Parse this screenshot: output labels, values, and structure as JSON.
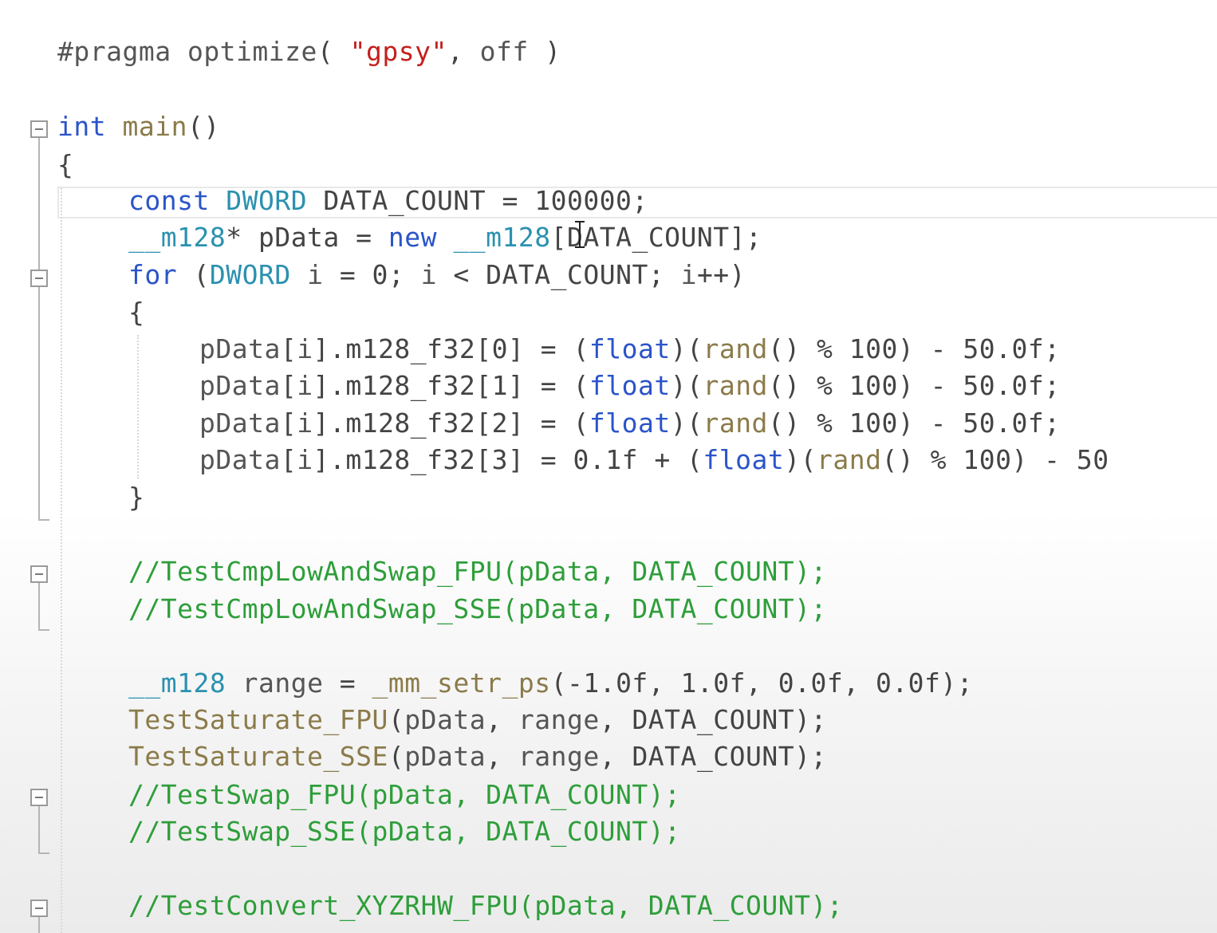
{
  "colors": {
    "keyword": "#2b54c9",
    "type": "#2b91af",
    "identifier": "#555555",
    "function": "#8b7b4a",
    "string": "#c3201e",
    "comment": "#2e9e3a",
    "number": "#3a3a3a",
    "punct": "#444444",
    "macro": "#555555"
  },
  "editor": {
    "lines": [
      {
        "tokens": [
          {
            "t": "#pragma",
            "c": "macro"
          },
          {
            "t": " optimize",
            "c": "macro"
          },
          {
            "t": "( ",
            "c": "punct"
          },
          {
            "t": "\"gpsy\"",
            "c": "string"
          },
          {
            "t": ", ",
            "c": "punct"
          },
          {
            "t": "off",
            "c": "macro"
          },
          {
            "t": " )",
            "c": "punct"
          }
        ]
      },
      {
        "tokens": [
          {
            "t": "int",
            "c": "keyword"
          },
          {
            "t": " ",
            "c": "punct"
          },
          {
            "t": "main",
            "c": "function"
          },
          {
            "t": "()",
            "c": "punct"
          }
        ]
      },
      {
        "tokens": [
          {
            "t": "{",
            "c": "punct"
          }
        ]
      },
      {
        "tokens": [
          {
            "t": "const",
            "c": "keyword"
          },
          {
            "t": " ",
            "c": "punct"
          },
          {
            "t": "DWORD",
            "c": "type"
          },
          {
            "t": " DATA_COUNT = 100000;",
            "c": "punct"
          }
        ]
      },
      {
        "tokens": [
          {
            "t": "__m128",
            "c": "type"
          },
          {
            "t": "* pData = ",
            "c": "punct"
          },
          {
            "t": "new",
            "c": "keyword"
          },
          {
            "t": " ",
            "c": "punct"
          },
          {
            "t": "__m128",
            "c": "type"
          },
          {
            "t": "[DATA_COUNT];",
            "c": "punct"
          }
        ]
      },
      {
        "tokens": [
          {
            "t": "for",
            "c": "keyword"
          },
          {
            "t": " (",
            "c": "punct"
          },
          {
            "t": "DWORD",
            "c": "type"
          },
          {
            "t": " ",
            "c": "punct"
          },
          {
            "t": "i",
            "c": "identifier"
          },
          {
            "t": " = 0; ",
            "c": "punct"
          },
          {
            "t": "i",
            "c": "identifier"
          },
          {
            "t": " < DATA_COUNT; ",
            "c": "punct"
          },
          {
            "t": "i",
            "c": "identifier"
          },
          {
            "t": "++)",
            "c": "punct"
          }
        ]
      },
      {
        "tokens": [
          {
            "t": "{",
            "c": "punct"
          }
        ]
      },
      {
        "tokens": [
          {
            "t": "pData",
            "c": "identifier"
          },
          {
            "t": "[",
            "c": "punct"
          },
          {
            "t": "i",
            "c": "identifier"
          },
          {
            "t": "].m128_f32[0] = (",
            "c": "punct"
          },
          {
            "t": "float",
            "c": "keyword"
          },
          {
            "t": ")(",
            "c": "punct"
          },
          {
            "t": "rand",
            "c": "function"
          },
          {
            "t": "() % 100) - 50.0f;",
            "c": "punct"
          }
        ]
      },
      {
        "tokens": [
          {
            "t": "pData",
            "c": "identifier"
          },
          {
            "t": "[",
            "c": "punct"
          },
          {
            "t": "i",
            "c": "identifier"
          },
          {
            "t": "].m128_f32[1] = (",
            "c": "punct"
          },
          {
            "t": "float",
            "c": "keyword"
          },
          {
            "t": ")(",
            "c": "punct"
          },
          {
            "t": "rand",
            "c": "function"
          },
          {
            "t": "() % 100) - 50.0f;",
            "c": "punct"
          }
        ]
      },
      {
        "tokens": [
          {
            "t": "pData",
            "c": "identifier"
          },
          {
            "t": "[",
            "c": "punct"
          },
          {
            "t": "i",
            "c": "identifier"
          },
          {
            "t": "].m128_f32[2] = (",
            "c": "punct"
          },
          {
            "t": "float",
            "c": "keyword"
          },
          {
            "t": ")(",
            "c": "punct"
          },
          {
            "t": "rand",
            "c": "function"
          },
          {
            "t": "() % 100) - 50.0f;",
            "c": "punct"
          }
        ]
      },
      {
        "tokens": [
          {
            "t": "pData",
            "c": "identifier"
          },
          {
            "t": "[",
            "c": "punct"
          },
          {
            "t": "i",
            "c": "identifier"
          },
          {
            "t": "].m128_f32[3] = 0.1f + (",
            "c": "punct"
          },
          {
            "t": "float",
            "c": "keyword"
          },
          {
            "t": ")(",
            "c": "punct"
          },
          {
            "t": "rand",
            "c": "function"
          },
          {
            "t": "() % 100) - 50",
            "c": "punct"
          }
        ]
      },
      {
        "tokens": [
          {
            "t": "}",
            "c": "punct"
          }
        ]
      },
      {
        "tokens": [
          {
            "t": "//TestCmpLowAndSwap_FPU(pData, DATA_COUNT);",
            "c": "comment"
          }
        ]
      },
      {
        "tokens": [
          {
            "t": "//TestCmpLowAndSwap_SSE(pData, DATA_COUNT);",
            "c": "comment"
          }
        ]
      },
      {
        "tokens": [
          {
            "t": "__m128",
            "c": "type"
          },
          {
            "t": " ",
            "c": "punct"
          },
          {
            "t": "range",
            "c": "identifier"
          },
          {
            "t": " = ",
            "c": "punct"
          },
          {
            "t": "_mm_setr_ps",
            "c": "function"
          },
          {
            "t": "(-1.0f, 1.0f, 0.0f, 0.0f);",
            "c": "punct"
          }
        ]
      },
      {
        "tokens": [
          {
            "t": "TestSaturate_FPU",
            "c": "function"
          },
          {
            "t": "(",
            "c": "punct"
          },
          {
            "t": "pData",
            "c": "identifier"
          },
          {
            "t": ", ",
            "c": "punct"
          },
          {
            "t": "range",
            "c": "identifier"
          },
          {
            "t": ", DATA_COUNT);",
            "c": "punct"
          }
        ]
      },
      {
        "tokens": [
          {
            "t": "TestSaturate_SSE",
            "c": "function"
          },
          {
            "t": "(",
            "c": "punct"
          },
          {
            "t": "pData",
            "c": "identifier"
          },
          {
            "t": ", ",
            "c": "punct"
          },
          {
            "t": "range",
            "c": "identifier"
          },
          {
            "t": ", DATA_COUNT);",
            "c": "punct"
          }
        ]
      },
      {
        "tokens": [
          {
            "t": "//TestSwap_FPU(pData, DATA_COUNT);",
            "c": "comment"
          }
        ]
      },
      {
        "tokens": [
          {
            "t": "//TestSwap_SSE(pData, DATA_COUNT);",
            "c": "comment"
          }
        ]
      },
      {
        "tokens": [
          {
            "t": "//TestConvert_XYZRHW_FPU(pData, DATA_COUNT);",
            "c": "comment"
          }
        ]
      }
    ]
  }
}
